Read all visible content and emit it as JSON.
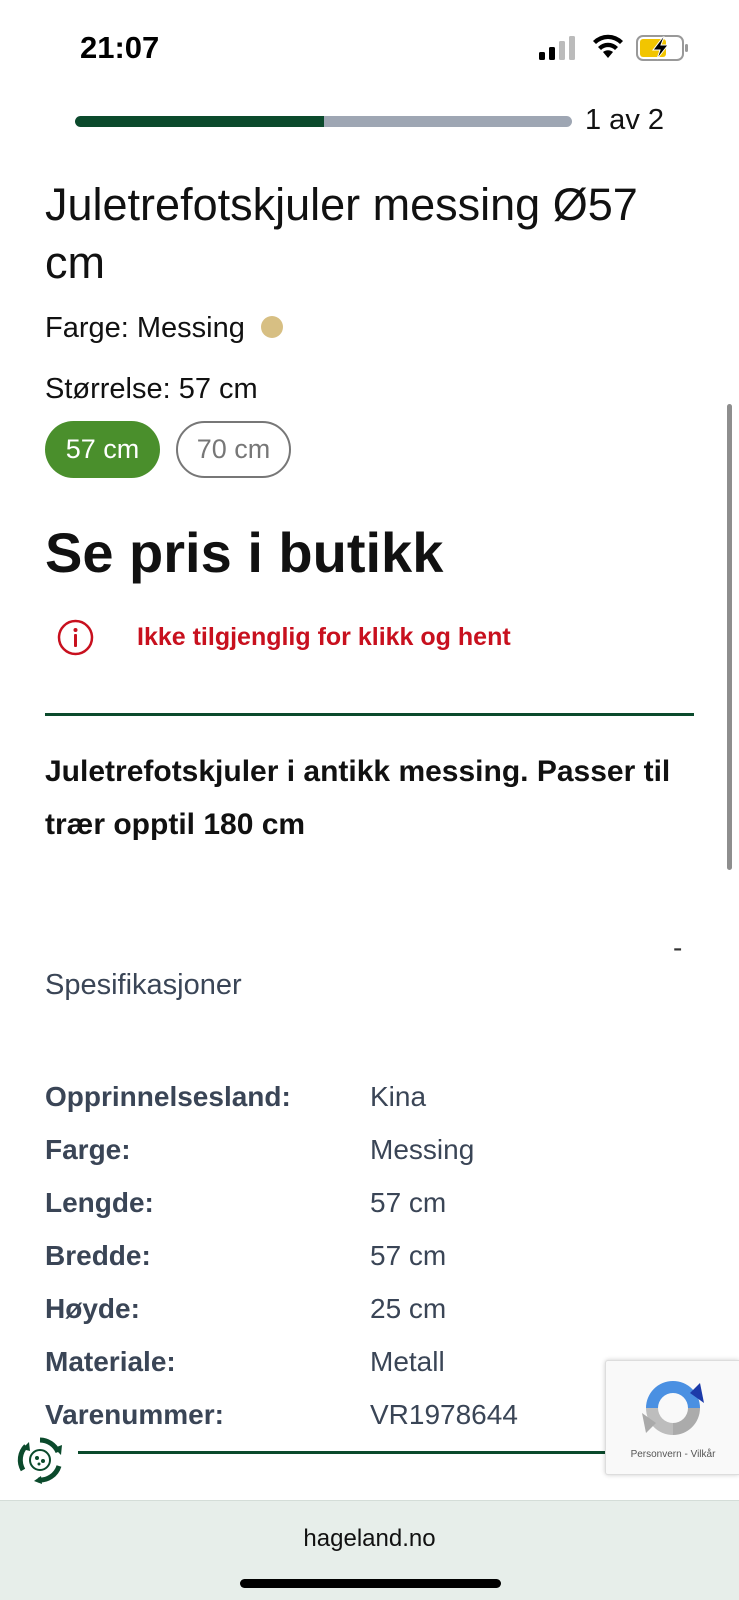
{
  "status_bar": {
    "time": "21:07",
    "icons": [
      "signal-icon",
      "wifi-icon",
      "battery-charging-icon"
    ]
  },
  "progress": {
    "text": "1 av 2",
    "fraction": 0.5,
    "fill_color": "#0b4a2c",
    "track_color": "#9ea6b3"
  },
  "product": {
    "title": "Juletrefotskjuler messing Ø57 cm",
    "color_label": "Farge: Messing",
    "color_swatch": "#d7bf83",
    "size_label": "Størrelse: 57 cm",
    "sizes": [
      {
        "label": "57 cm",
        "selected": true
      },
      {
        "label": "70 cm",
        "selected": false
      }
    ],
    "price_text": "Se pris i butikk",
    "availability": "Ikke tilgjenglig for klikk og hent",
    "availability_color": "#c8101e",
    "description": "Juletrefotskjuler i antikk messing. Passer til trær opptil 180 cm"
  },
  "specs": {
    "toggle_symbol": "-",
    "heading": "Spesifikasjoner",
    "rows": [
      {
        "key": "Opprinnelsesland:",
        "value": "Kina"
      },
      {
        "key": "Farge:",
        "value": "Messing"
      },
      {
        "key": "Lengde:",
        "value": "57 cm"
      },
      {
        "key": "Bredde:",
        "value": "57 cm"
      },
      {
        "key": "Høyde:",
        "value": "25 cm"
      },
      {
        "key": "Materiale:",
        "value": "Metall"
      },
      {
        "key": "Varenummer:",
        "value": "VR1978644"
      }
    ]
  },
  "recaptcha": {
    "links": "Personvern - Vilkår"
  },
  "browser": {
    "url": "hageland.no"
  },
  "colors": {
    "brand_green": "#0b4a2c",
    "chip_green": "#4a8f2c"
  }
}
